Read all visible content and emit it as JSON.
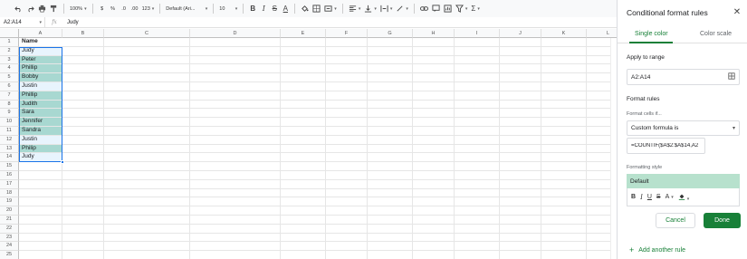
{
  "toolbar": {
    "zoom": "100%",
    "currency": "$",
    "percent": "%",
    "dec_decrease": ".0",
    "dec_increase": ".00",
    "format_more": "123",
    "font": "Default (Ari...",
    "font_size": "10"
  },
  "formula_bar": {
    "name_box": "A2:A14",
    "fx": "fx",
    "value": "Judy"
  },
  "grid": {
    "columns": [
      "A",
      "B",
      "C",
      "D",
      "E",
      "F",
      "G",
      "H",
      "I",
      "J",
      "K",
      "L"
    ],
    "rows": [
      "1",
      "2",
      "3",
      "4",
      "5",
      "6",
      "7",
      "8",
      "9",
      "10",
      "11",
      "12",
      "13",
      "14",
      "15",
      "16",
      "17",
      "18",
      "19",
      "20",
      "21",
      "22",
      "23",
      "24",
      "25"
    ],
    "column_a": [
      {
        "text": "Name",
        "style": "bold"
      },
      {
        "text": "Judy",
        "style": "light"
      },
      {
        "text": "Peter",
        "style": "teal"
      },
      {
        "text": "Phillip",
        "style": "teal"
      },
      {
        "text": "Bobby",
        "style": "teal"
      },
      {
        "text": "Justin",
        "style": "light"
      },
      {
        "text": "Phillip",
        "style": "teal"
      },
      {
        "text": "Judith",
        "style": "teal"
      },
      {
        "text": "Sara",
        "style": "teal"
      },
      {
        "text": "Jennifer",
        "style": "teal"
      },
      {
        "text": "Sandra",
        "style": "teal"
      },
      {
        "text": "Justin",
        "style": "light"
      },
      {
        "text": "Philip",
        "style": "teal"
      },
      {
        "text": "Judy",
        "style": "light"
      }
    ]
  },
  "sidebar": {
    "title": "Conditional format rules",
    "tabs": [
      "Single color",
      "Color scale"
    ],
    "apply_to_range_label": "Apply to range",
    "range_value": "A2:A14",
    "format_rules_label": "Format rules",
    "format_cells_if_label": "Format cells if...",
    "condition": "Custom formula is",
    "formula": "=COUNTIF($A$2:$A$14,A2",
    "formatting_style_label": "Formatting style",
    "style_preset": "Default",
    "cancel": "Cancel",
    "done": "Done",
    "add_rule": "Add another rule"
  },
  "colors": {
    "accent": "#188038",
    "highlight_teal": "#a8d8d1",
    "highlight_light": "#e8f4fd",
    "style_preview": "#b7e1cd",
    "selection": "#1a73e8"
  }
}
